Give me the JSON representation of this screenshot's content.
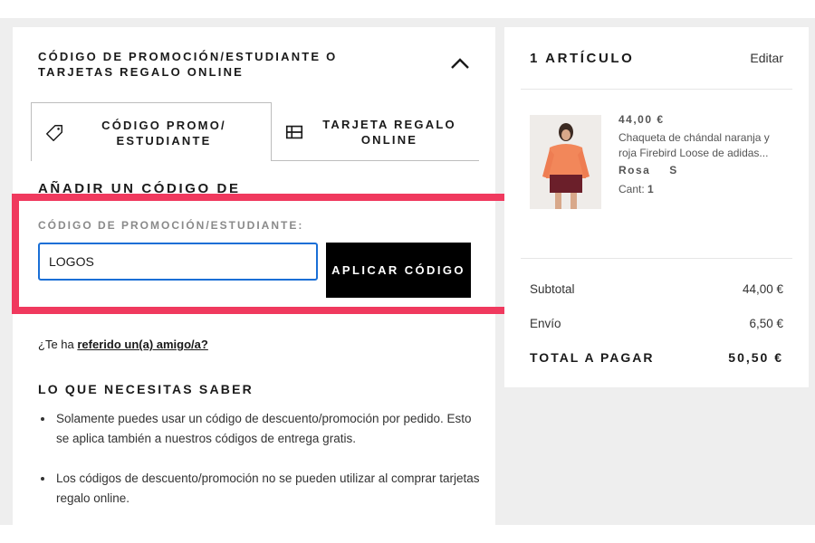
{
  "promo_section": {
    "header": "CÓDIGO DE PROMOCIÓN/ESTUDIANTE O TARJETAS REGALO ONLINE",
    "tabs": [
      {
        "label": "CÓDIGO PROMO/ ESTUDIANTE",
        "icon": "tag-icon",
        "active": true
      },
      {
        "label": "TARJETA REGALO ONLINE",
        "icon": "gift-card-icon",
        "active": false
      }
    ],
    "title": "AÑADIR UN CÓDIGO DE PROMOCIÓN/ESTUDIANTE",
    "field_label": "CÓDIGO DE PROMOCIÓN/ESTUDIANTE:",
    "input_value": "LOGOS",
    "apply_button": "APLICAR CÓDIGO",
    "highlight_color": "#f0395e"
  },
  "referral": {
    "prefix": "¿Te ha",
    "link": "referido un(a) amigo/a?"
  },
  "need_to_know": {
    "title": "LO QUE NECESITAS SABER",
    "bullets": [
      "Solamente puedes usar un código de descuento/promoción por pedido. Esto se aplica también a nuestros códigos de entrega gratis.",
      "Los códigos de descuento/promoción no se pueden utilizar al comprar tarjetas regalo online."
    ]
  },
  "cart": {
    "title": "1 ARTÍCULO",
    "edit": "Editar",
    "item": {
      "price": "44,00 €",
      "name": "Chaqueta de chándal naranja y roja Firebird Loose de adidas...",
      "color": "Rosa",
      "size": "S",
      "qty_label": "Cant:",
      "qty": "1"
    },
    "summary": {
      "subtotal_label": "Subtotal",
      "subtotal": "44,00 €",
      "shipping_label": "Envío",
      "shipping": "6,50 €",
      "total_label": "TOTAL A PAGAR",
      "total": "50,50 €"
    }
  }
}
